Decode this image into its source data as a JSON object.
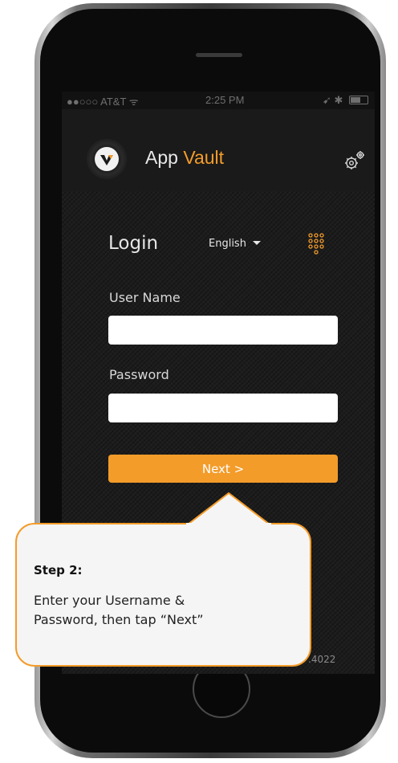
{
  "status_bar": {
    "carrier": "●●○○○ AT&T ᯤ",
    "time": "2:25 PM",
    "right": "➹ ✱"
  },
  "header": {
    "title_part1": "App",
    "title_part2": "Vault",
    "settings_icon": "gears-icon"
  },
  "login": {
    "title": "Login",
    "language": "English",
    "keypad_icon": "keypad-icon"
  },
  "form": {
    "username_label": "User Name",
    "username_value": "",
    "password_label": "Password",
    "password_value": "",
    "next_label": "Next >"
  },
  "footer": {
    "version": ".4022"
  },
  "callout": {
    "title": "Step 2:",
    "line1": "Enter your Username &",
    "line2": "Password, then tap “Next”"
  },
  "colors": {
    "accent": "#f39c2a",
    "screen_bg": "#1c1c1c"
  }
}
